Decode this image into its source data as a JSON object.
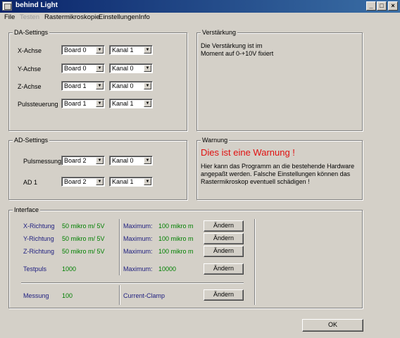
{
  "window": {
    "title": "behind Light"
  },
  "menu": {
    "items": [
      "File",
      "Testen",
      "Rastermikroskopie",
      "Einstellungen",
      "Info"
    ]
  },
  "da_settings": {
    "title": "DA-Settings",
    "rows": [
      {
        "label": "X-Achse",
        "board": "Board 0",
        "kanal": "Kanal 1"
      },
      {
        "label": "Y-Achse",
        "board": "Board 0",
        "kanal": "Kanal 0"
      },
      {
        "label": "Z-Achse",
        "board": "Board 1",
        "kanal": "Kanal 0"
      },
      {
        "label": "Pulssteuerung",
        "board": "Board 1",
        "kanal": "Kanal 1"
      }
    ]
  },
  "verstaerkung": {
    "title": "Verstärkung",
    "text_line1": "Die Verstärkung ist im",
    "text_line2": "Moment auf 0-+10V fixiert"
  },
  "ad_settings": {
    "title": "AD-Settings",
    "rows": [
      {
        "label": "Pulsmessung",
        "board": "Board 2",
        "kanal": "Kanal 0"
      },
      {
        "label": "AD 1",
        "board": "Board 2",
        "kanal": "Kanal 1"
      }
    ]
  },
  "warnung": {
    "title": "Warnung",
    "headline": "Dies ist eine Warnung !",
    "line1": "Hier kann das Programm an die bestehende Hardware",
    "line2": "angepaßt werden. Falsche Einstellungen können das",
    "line3": "Rastermikroskop eventuell schädigen !"
  },
  "interface": {
    "title": "Interface",
    "rows": [
      {
        "label": "X-Richtung",
        "value": "50 mikro m/ 5V",
        "max_label": "Maximum:",
        "max_value": "100 mikro m",
        "button": "Ändern"
      },
      {
        "label": "Y-Richtung",
        "value": "50 mikro m/ 5V",
        "max_label": "Maximum:",
        "max_value": "100 mikro m",
        "button": "Ändern"
      },
      {
        "label": "Z-Richtung",
        "value": "50 mikro m/ 5V",
        "max_label": "Maximum:",
        "max_value": "100 mikro m",
        "button": "Ändern"
      },
      {
        "label": "Testpuls",
        "value": "1000",
        "max_label": "Maximum:",
        "max_value": "10000",
        "button": "Ändern"
      }
    ],
    "messung": {
      "label": "Messung",
      "value": "100",
      "clamp_label": "Current-Clamp",
      "button": "Ändern"
    }
  },
  "ok_button": "OK"
}
